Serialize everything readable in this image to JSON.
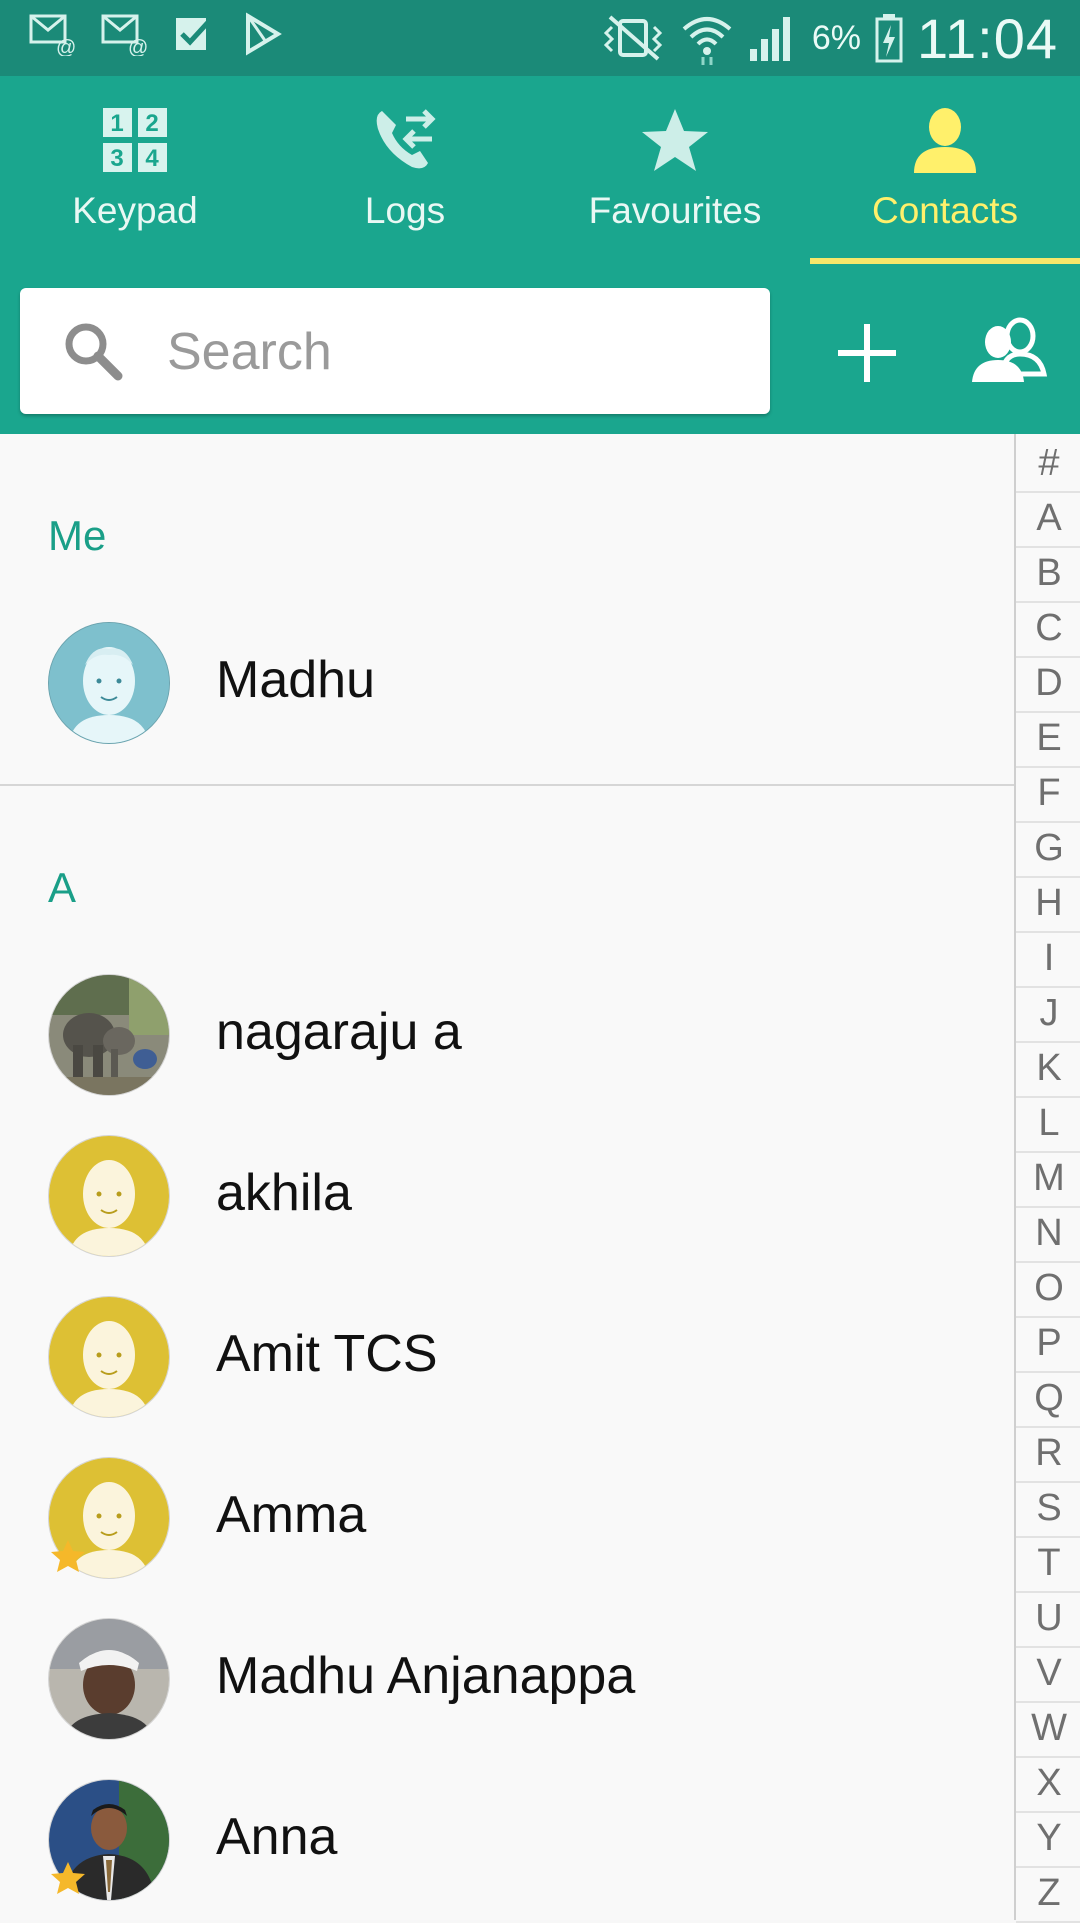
{
  "status_bar": {
    "left_icons": [
      "email-notification-icon",
      "email-notification-icon",
      "task-done-icon",
      "play-store-icon"
    ],
    "right_icons": [
      "vibrate-mute-icon",
      "wifi-icon",
      "signal-icon",
      "battery-charging-icon"
    ],
    "battery_percent": "6%",
    "time": "11:04"
  },
  "tabs": [
    {
      "label": "Keypad",
      "icon": "keypad-icon",
      "active": false
    },
    {
      "label": "Logs",
      "icon": "call-logs-icon",
      "active": false
    },
    {
      "label": "Favourites",
      "icon": "star-icon",
      "active": false
    },
    {
      "label": "Contacts",
      "icon": "contact-person-icon",
      "active": true
    }
  ],
  "search": {
    "placeholder": "Search"
  },
  "actions": {
    "add": "add-icon",
    "groups": "groups-icon"
  },
  "me_section": {
    "header": "Me",
    "name": "Madhu",
    "avatar": "default-avatar-blue"
  },
  "a_section": {
    "header": "A"
  },
  "contacts": [
    {
      "name": "nagaraju a",
      "avatar": "photo-elephants",
      "favourite": false
    },
    {
      "name": "akhila",
      "avatar": "default-avatar-yellow",
      "favourite": false
    },
    {
      "name": "Amit TCS",
      "avatar": "default-avatar-yellow",
      "favourite": false
    },
    {
      "name": "Amma",
      "avatar": "default-avatar-yellow",
      "favourite": true
    },
    {
      "name": "Madhu Anjanappa",
      "avatar": "photo-man-cap",
      "favourite": false
    },
    {
      "name": "Anna",
      "avatar": "photo-man-suit",
      "favourite": true
    }
  ],
  "index_letters": [
    "#",
    "A",
    "B",
    "C",
    "D",
    "E",
    "F",
    "G",
    "H",
    "I",
    "J",
    "K",
    "L",
    "M",
    "N",
    "O",
    "P",
    "Q",
    "R",
    "S",
    "T",
    "U",
    "V",
    "W",
    "X",
    "Y",
    "Z"
  ],
  "colors": {
    "header": "#1aa68e",
    "status_bar": "#1b8a78",
    "active_tab": "#fff06b",
    "section_header": "#1a9f88"
  }
}
